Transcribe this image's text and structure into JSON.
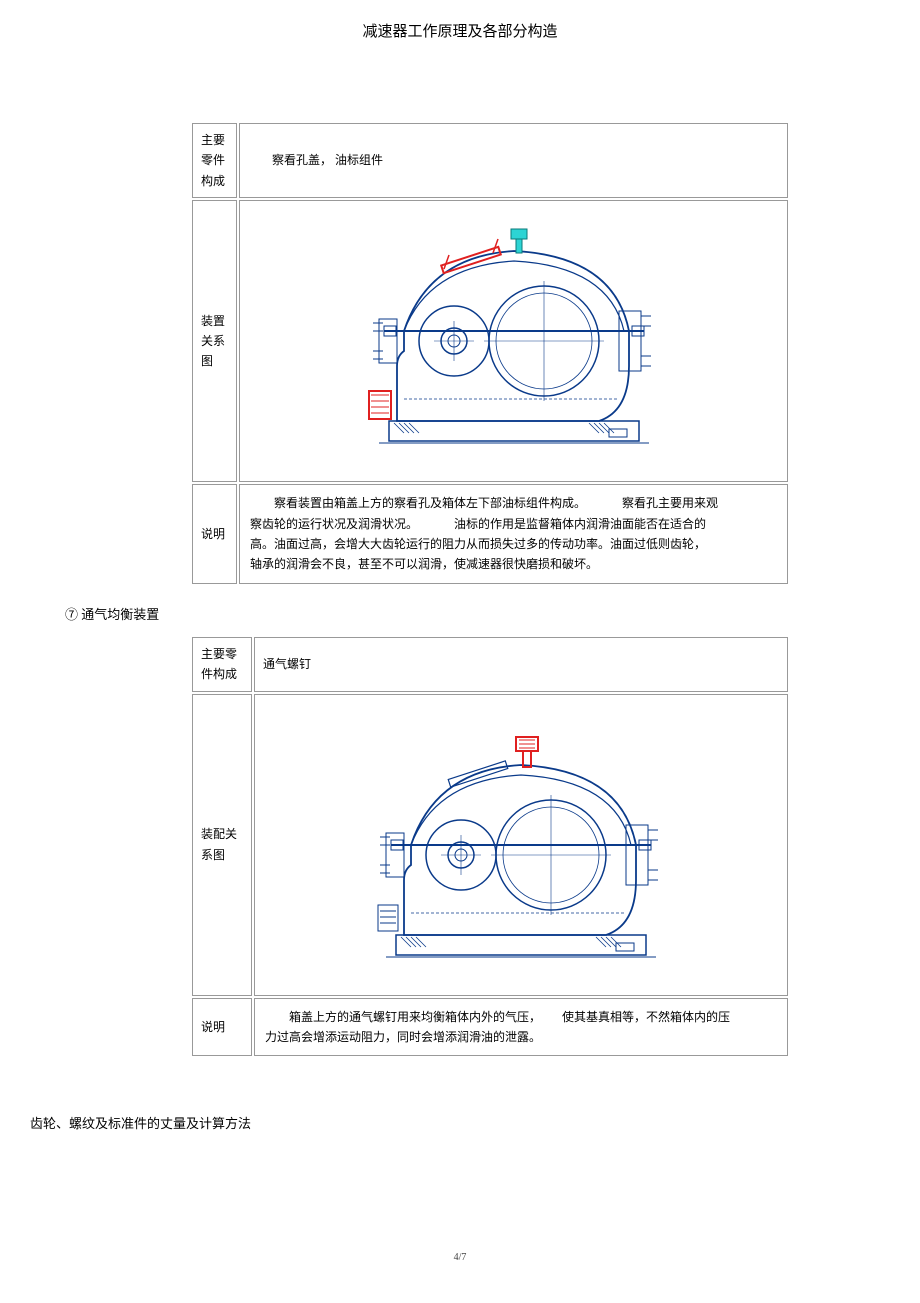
{
  "header": {
    "title": "减速器工作原理及各部分构造"
  },
  "table1": {
    "row1_label": "主要零件构成",
    "row1_value": "察看孔盖，  油标组件",
    "row2_label": "装置关系图",
    "row3_label": "说明",
    "row3_value_part1": "察看装置由箱盖上方的察看孔及箱体左下部油标组件构成。",
    "row3_value_part2": "察看孔主要用来观",
    "row3_value_part3": "察齿轮的运行状况及润滑状况。",
    "row3_value_part4": "油标的作用是监督箱体内润滑油面能否在适合的",
    "row3_value_part5": "高。油面过高，会增大大齿轮运行的阻力从而损失过多的传动功率。油面过低则齿轮，",
    "row3_value_part6": "轴承的润滑会不良，甚至不可以润滑，使减速器很快磨损和破坏。"
  },
  "section7_label": "⑦   通气均衡装置",
  "table2": {
    "row1_label": "主要零件构成",
    "row1_value": "通气螺钉",
    "row2_label": "装配关系图",
    "row3_label": "说明",
    "row3_value_part1": "箱盖上方的通气螺钉用来均衡箱体内外的气压，",
    "row3_value_part2": "使其基真相等，不然箱体内的压",
    "row3_value_part3": "力过高会增添运动阻力，同时会增添润滑油的泄露。"
  },
  "bottom_heading": "齿轮、螺纹及标准件的丈量及计算方法",
  "page_number": "4/7"
}
